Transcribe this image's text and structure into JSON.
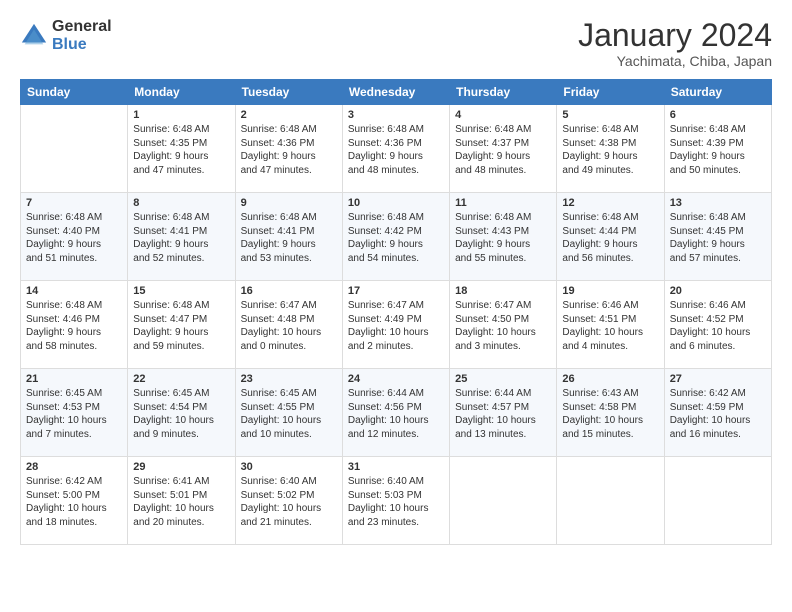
{
  "header": {
    "logo_general": "General",
    "logo_blue": "Blue",
    "title": "January 2024",
    "subtitle": "Yachimata, Chiba, Japan"
  },
  "days_of_week": [
    "Sunday",
    "Monday",
    "Tuesday",
    "Wednesday",
    "Thursday",
    "Friday",
    "Saturday"
  ],
  "weeks": [
    [
      {
        "day": "",
        "info": ""
      },
      {
        "day": "1",
        "info": "Sunrise: 6:48 AM\nSunset: 4:35 PM\nDaylight: 9 hours\nand 47 minutes."
      },
      {
        "day": "2",
        "info": "Sunrise: 6:48 AM\nSunset: 4:36 PM\nDaylight: 9 hours\nand 47 minutes."
      },
      {
        "day": "3",
        "info": "Sunrise: 6:48 AM\nSunset: 4:36 PM\nDaylight: 9 hours\nand 48 minutes."
      },
      {
        "day": "4",
        "info": "Sunrise: 6:48 AM\nSunset: 4:37 PM\nDaylight: 9 hours\nand 48 minutes."
      },
      {
        "day": "5",
        "info": "Sunrise: 6:48 AM\nSunset: 4:38 PM\nDaylight: 9 hours\nand 49 minutes."
      },
      {
        "day": "6",
        "info": "Sunrise: 6:48 AM\nSunset: 4:39 PM\nDaylight: 9 hours\nand 50 minutes."
      }
    ],
    [
      {
        "day": "7",
        "info": "Sunrise: 6:48 AM\nSunset: 4:40 PM\nDaylight: 9 hours\nand 51 minutes."
      },
      {
        "day": "8",
        "info": "Sunrise: 6:48 AM\nSunset: 4:41 PM\nDaylight: 9 hours\nand 52 minutes."
      },
      {
        "day": "9",
        "info": "Sunrise: 6:48 AM\nSunset: 4:41 PM\nDaylight: 9 hours\nand 53 minutes."
      },
      {
        "day": "10",
        "info": "Sunrise: 6:48 AM\nSunset: 4:42 PM\nDaylight: 9 hours\nand 54 minutes."
      },
      {
        "day": "11",
        "info": "Sunrise: 6:48 AM\nSunset: 4:43 PM\nDaylight: 9 hours\nand 55 minutes."
      },
      {
        "day": "12",
        "info": "Sunrise: 6:48 AM\nSunset: 4:44 PM\nDaylight: 9 hours\nand 56 minutes."
      },
      {
        "day": "13",
        "info": "Sunrise: 6:48 AM\nSunset: 4:45 PM\nDaylight: 9 hours\nand 57 minutes."
      }
    ],
    [
      {
        "day": "14",
        "info": "Sunrise: 6:48 AM\nSunset: 4:46 PM\nDaylight: 9 hours\nand 58 minutes."
      },
      {
        "day": "15",
        "info": "Sunrise: 6:48 AM\nSunset: 4:47 PM\nDaylight: 9 hours\nand 59 minutes."
      },
      {
        "day": "16",
        "info": "Sunrise: 6:47 AM\nSunset: 4:48 PM\nDaylight: 10 hours\nand 0 minutes."
      },
      {
        "day": "17",
        "info": "Sunrise: 6:47 AM\nSunset: 4:49 PM\nDaylight: 10 hours\nand 2 minutes."
      },
      {
        "day": "18",
        "info": "Sunrise: 6:47 AM\nSunset: 4:50 PM\nDaylight: 10 hours\nand 3 minutes."
      },
      {
        "day": "19",
        "info": "Sunrise: 6:46 AM\nSunset: 4:51 PM\nDaylight: 10 hours\nand 4 minutes."
      },
      {
        "day": "20",
        "info": "Sunrise: 6:46 AM\nSunset: 4:52 PM\nDaylight: 10 hours\nand 6 minutes."
      }
    ],
    [
      {
        "day": "21",
        "info": "Sunrise: 6:45 AM\nSunset: 4:53 PM\nDaylight: 10 hours\nand 7 minutes."
      },
      {
        "day": "22",
        "info": "Sunrise: 6:45 AM\nSunset: 4:54 PM\nDaylight: 10 hours\nand 9 minutes."
      },
      {
        "day": "23",
        "info": "Sunrise: 6:45 AM\nSunset: 4:55 PM\nDaylight: 10 hours\nand 10 minutes."
      },
      {
        "day": "24",
        "info": "Sunrise: 6:44 AM\nSunset: 4:56 PM\nDaylight: 10 hours\nand 12 minutes."
      },
      {
        "day": "25",
        "info": "Sunrise: 6:44 AM\nSunset: 4:57 PM\nDaylight: 10 hours\nand 13 minutes."
      },
      {
        "day": "26",
        "info": "Sunrise: 6:43 AM\nSunset: 4:58 PM\nDaylight: 10 hours\nand 15 minutes."
      },
      {
        "day": "27",
        "info": "Sunrise: 6:42 AM\nSunset: 4:59 PM\nDaylight: 10 hours\nand 16 minutes."
      }
    ],
    [
      {
        "day": "28",
        "info": "Sunrise: 6:42 AM\nSunset: 5:00 PM\nDaylight: 10 hours\nand 18 minutes."
      },
      {
        "day": "29",
        "info": "Sunrise: 6:41 AM\nSunset: 5:01 PM\nDaylight: 10 hours\nand 20 minutes."
      },
      {
        "day": "30",
        "info": "Sunrise: 6:40 AM\nSunset: 5:02 PM\nDaylight: 10 hours\nand 21 minutes."
      },
      {
        "day": "31",
        "info": "Sunrise: 6:40 AM\nSunset: 5:03 PM\nDaylight: 10 hours\nand 23 minutes."
      },
      {
        "day": "",
        "info": ""
      },
      {
        "day": "",
        "info": ""
      },
      {
        "day": "",
        "info": ""
      }
    ]
  ]
}
